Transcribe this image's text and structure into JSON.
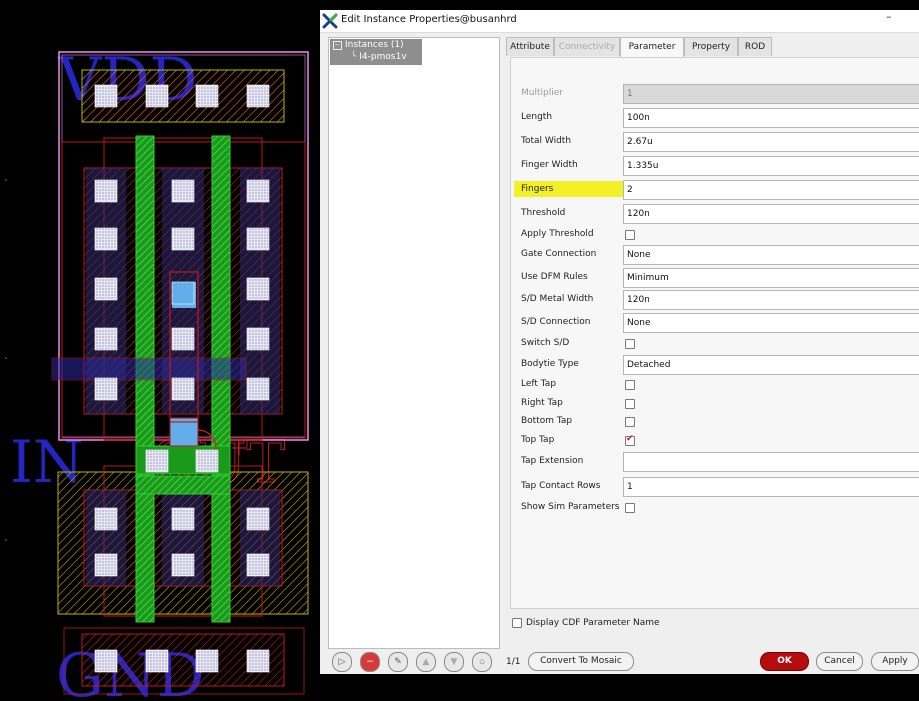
{
  "layout": {
    "labels": {
      "vdd": "VDD",
      "in": "IN",
      "out": "OUT",
      "gnd": "GND"
    }
  },
  "dialog": {
    "title": "Edit Instance Properties@busanhrd",
    "minimize": "–",
    "tree": {
      "root": "Instances (1)",
      "child": "I4-pmos1v"
    },
    "tabs": [
      "Attribute",
      "Connectivity",
      "Parameter",
      "Property",
      "ROD"
    ],
    "params": [
      {
        "label": "Multiplier",
        "type": "text",
        "value": "1",
        "disabled": true
      },
      {
        "label": "Length",
        "type": "text",
        "value": "100n"
      },
      {
        "label": "Total Width",
        "type": "text",
        "value": "2.67u"
      },
      {
        "label": "Finger Width",
        "type": "text",
        "value": "1.335u"
      },
      {
        "label": "Fingers",
        "type": "text",
        "value": "2",
        "highlight": true
      },
      {
        "label": "Threshold",
        "type": "text",
        "value": "120n"
      },
      {
        "label": "Apply Threshold",
        "type": "check",
        "checked": false
      },
      {
        "label": "Gate Connection",
        "type": "select",
        "value": "None"
      },
      {
        "label": "Use DFM Rules",
        "type": "select",
        "value": "Minimum"
      },
      {
        "label": "S/D Metal Width",
        "type": "text",
        "value": "120n"
      },
      {
        "label": "S/D Connection",
        "type": "select",
        "value": "None"
      },
      {
        "label": "Switch S/D",
        "type": "check",
        "checked": false
      },
      {
        "label": "Bodytie Type",
        "type": "select",
        "value": "Detached"
      },
      {
        "label": "Left Tap",
        "type": "check",
        "checked": false
      },
      {
        "label": "Right Tap",
        "type": "check",
        "checked": false
      },
      {
        "label": "Bottom Tap",
        "type": "check",
        "checked": false
      },
      {
        "label": "Top Tap",
        "type": "check",
        "checked": true
      },
      {
        "label": "Tap Extension",
        "type": "text",
        "value": ""
      },
      {
        "label": "Tap Contact Rows",
        "type": "text",
        "value": "1"
      },
      {
        "label": "Show Sim Parameters",
        "type": "check",
        "checked": false
      }
    ],
    "display_cdf": "Display CDF Parameter Name",
    "pager": "1/1",
    "buttons": {
      "mosaic": "Convert To Mosaic",
      "ok": "OK",
      "cancel": "Cancel",
      "apply": "Apply"
    },
    "colors": {
      "ok_button": "#b50d0d",
      "highlight": "#f2f000"
    }
  }
}
